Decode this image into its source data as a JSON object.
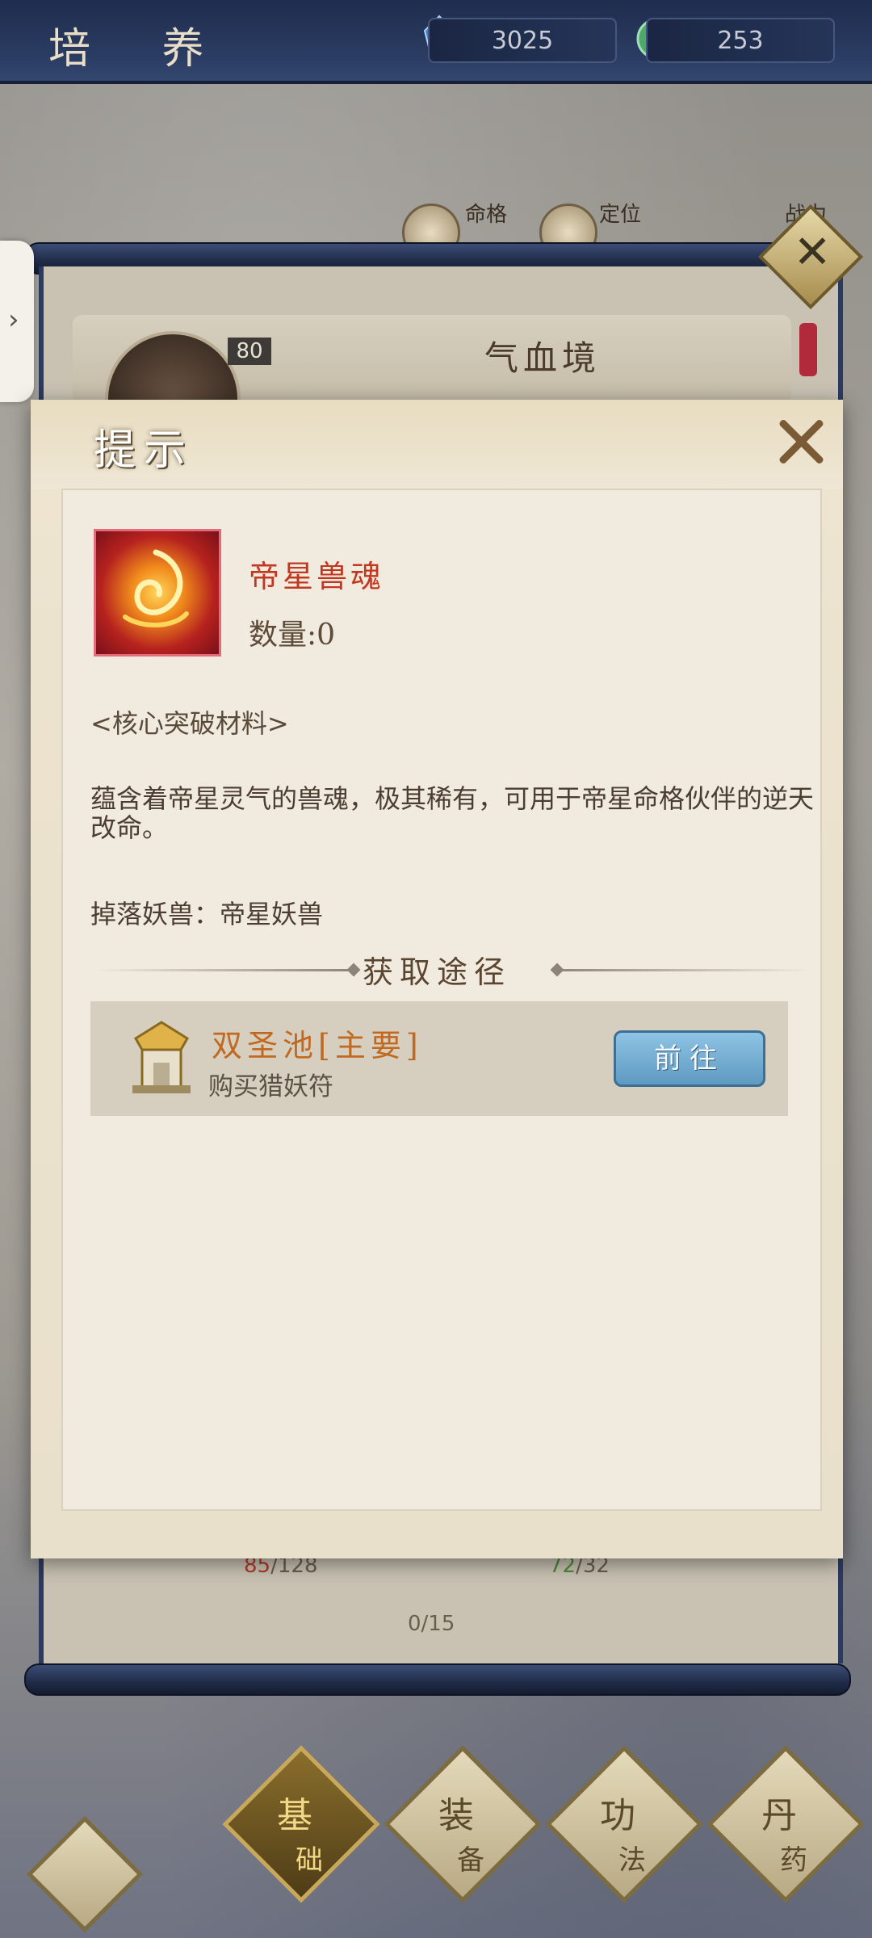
{
  "header": {
    "title": "培 养",
    "resources": [
      {
        "icon": "blue-crystal-icon",
        "value": "3025"
      },
      {
        "icon": "jade-coin-icon",
        "value": "253"
      }
    ]
  },
  "background_panel": {
    "info_labels": [
      "命格",
      "定位",
      "战力"
    ],
    "realm_title": "气血境",
    "level": "80",
    "counters": {
      "left_red": "85",
      "left_total": "/128",
      "center": "0/15",
      "right_green": "72",
      "right_total": "/32"
    }
  },
  "dialog": {
    "title": "提示",
    "item": {
      "name": "帝星兽魂",
      "quantity": "数量:0",
      "category": "<核心突破材料>",
      "description": "蕴含着帝星灵气的兽魂，极其稀有，可用于帝星命格伙伴的逆天改命。",
      "drop": "掉落妖兽：帝星妖兽"
    },
    "obtain_title": "获取途径",
    "routes": [
      {
        "name": "双圣池[主要]",
        "sub": "购买猎妖符",
        "button": "前往"
      }
    ]
  },
  "bottom_nav": [
    {
      "main": "基",
      "sub": "础",
      "active": true
    },
    {
      "main": "装",
      "sub": "备",
      "active": false
    },
    {
      "main": "功",
      "sub": "法",
      "active": false
    },
    {
      "main": "丹",
      "sub": "药",
      "active": false
    }
  ],
  "colors": {
    "accent_red": "#c2371f",
    "route_orange": "#c1691f",
    "button_blue": "#5f9ac2",
    "frame_navy": "#1f2d4d"
  }
}
